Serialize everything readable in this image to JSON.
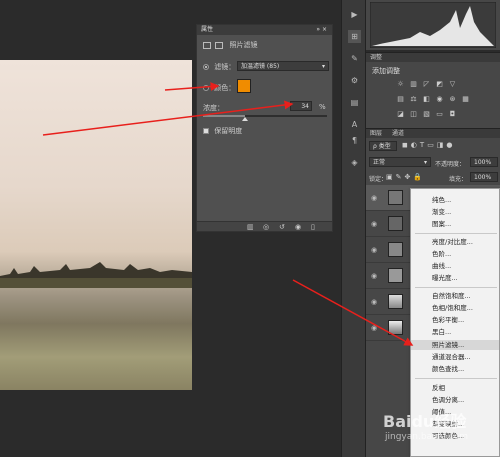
{
  "properties": {
    "title": "属性",
    "subtitle": "照片滤镜",
    "filter_label": "滤镜：",
    "filter_value": "加温滤镜 (85)",
    "color_label": "颜色：",
    "color_value": "#f08c00",
    "density_label": "浓度：",
    "density_value": "34",
    "density_unit": "%",
    "density_fraction": 0.34,
    "preserve_label": "保留明度"
  },
  "adjust_panel": {
    "tab": "调整",
    "add_label": "添加调整"
  },
  "layers_panel": {
    "tab1": "图层",
    "tab2": "通道",
    "kind_label": "ρ 类型",
    "blend_mode": "正常",
    "opacity_label": "不透明度：",
    "opacity_value": "100%",
    "lock_label": "锁定：",
    "fill_label": "填充：",
    "fill_value": "100%"
  },
  "context_menu": {
    "items": [
      "纯色...",
      "渐变...",
      "图案...",
      "亮度/对比度...",
      "色阶...",
      "曲线...",
      "曝光度...",
      "自然饱和度...",
      "色相/饱和度...",
      "色彩平衡...",
      "黑白...",
      "照片滤镜...",
      "通道混合器...",
      "颜色查找...",
      "反相",
      "色调分离...",
      "阈值...",
      "渐变映射...",
      "可选颜色..."
    ]
  },
  "watermark": {
    "brand": "Baidu经验",
    "url": "jingyan.baidu.com"
  }
}
